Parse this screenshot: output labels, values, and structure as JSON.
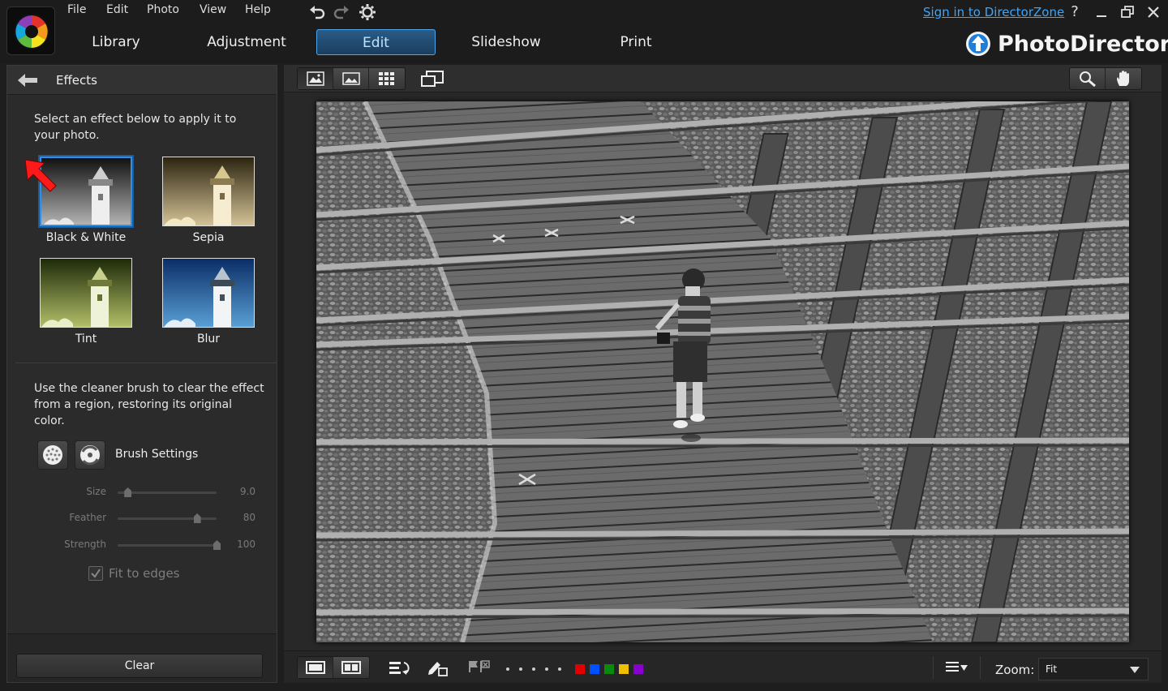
{
  "menu": {
    "file": "File",
    "edit": "Edit",
    "photo": "Photo",
    "view": "View",
    "help": "Help"
  },
  "quick_access": {
    "undo_icon": "undo-icon",
    "redo_icon": "redo-icon",
    "settings_icon": "gear-icon"
  },
  "header": {
    "signin": "Sign in to DirectorZone",
    "help": "?",
    "brand": "PhotoDirector"
  },
  "tabs": [
    {
      "label": "Library"
    },
    {
      "label": "Adjustment"
    },
    {
      "label": "Edit",
      "active": true
    },
    {
      "label": "Slideshow"
    },
    {
      "label": "Print"
    }
  ],
  "panel": {
    "title": "Effects",
    "instruction": "Select an effect below to apply it to your photo.",
    "effects": [
      {
        "label": "Black & White",
        "selected": true
      },
      {
        "label": "Sepia"
      },
      {
        "label": "Tint"
      },
      {
        "label": "Blur"
      }
    ],
    "cleaner_instruction": "Use the cleaner brush to clear the effect from a region, restoring its original color.",
    "brush_settings": "Brush Settings",
    "sliders": [
      {
        "label": "Size",
        "value": "9.0",
        "fraction": 0.1
      },
      {
        "label": "Feather",
        "value": "80",
        "fraction": 0.8
      },
      {
        "label": "Strength",
        "value": "100",
        "fraction": 1.0
      }
    ],
    "fit_to_edges": "Fit to edges",
    "fit_checked": true,
    "clear": "Clear"
  },
  "bottom": {
    "zoom_label": "Zoom:",
    "zoom_value": "Fit",
    "color_tags": [
      "#e00000",
      "#0050ff",
      "#0a8a0a",
      "#f0c000",
      "#8a00d0"
    ]
  },
  "colors": {
    "accent": "#2f8fe6",
    "link": "#3aa7ff"
  }
}
